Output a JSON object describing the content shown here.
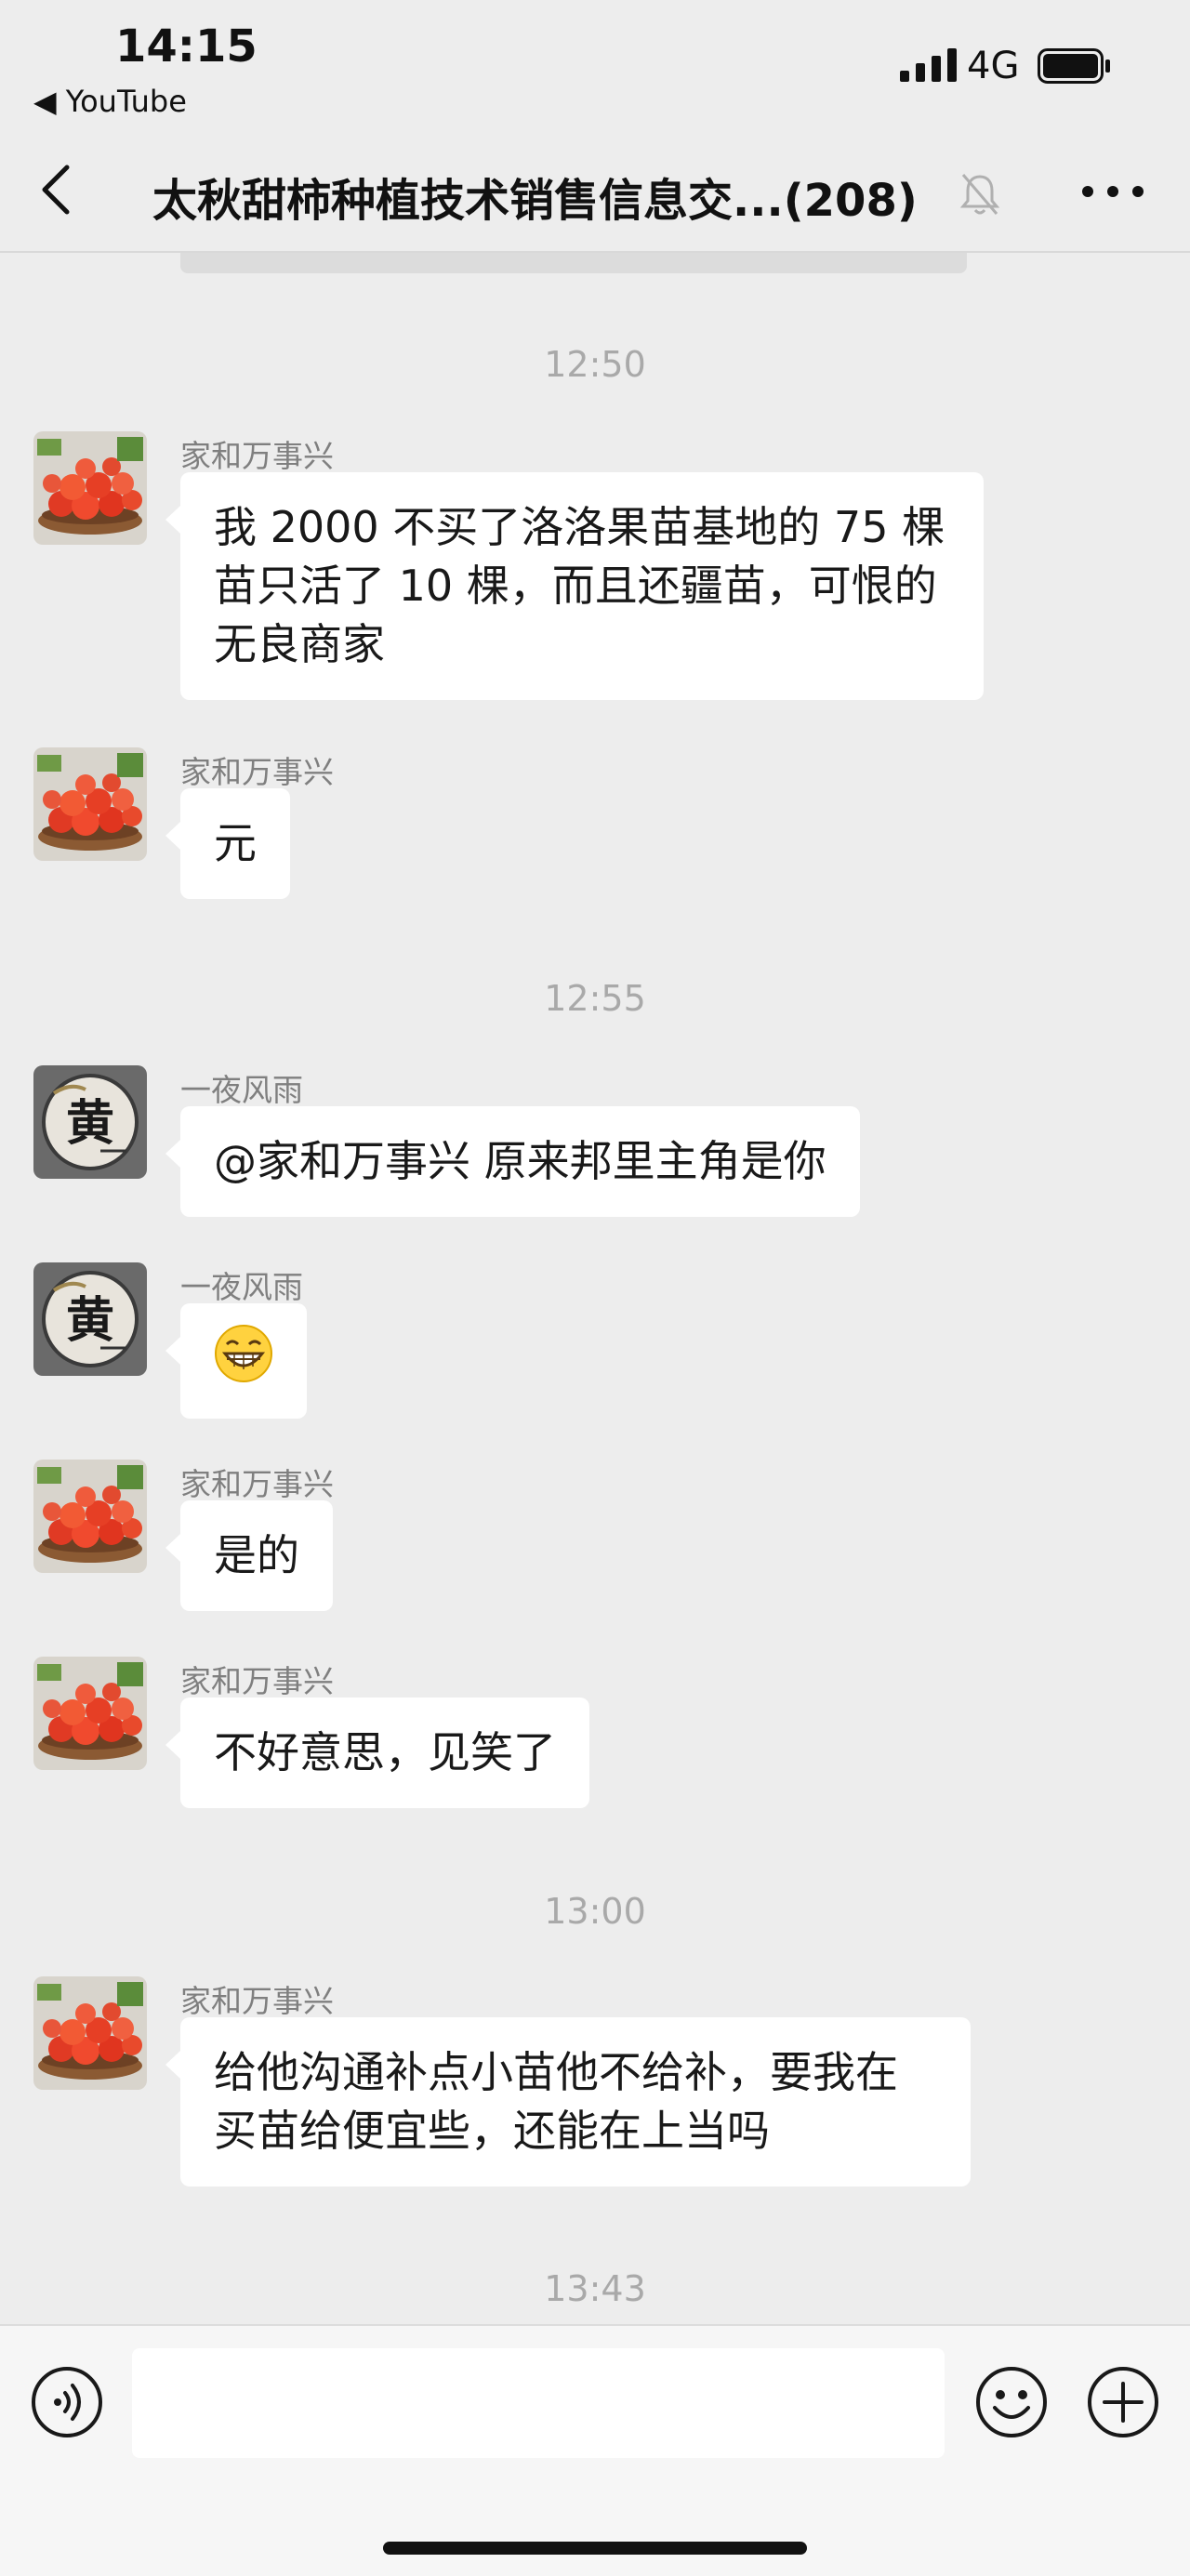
{
  "status_bar": {
    "time": "14:15",
    "back_app": "◀ YouTube",
    "network": "4G"
  },
  "header": {
    "title": "太秋甜柿种植技术销售信息交...(208)"
  },
  "messages": [
    {
      "type": "time",
      "text": "12:50"
    },
    {
      "type": "msg",
      "sender": "家和万事兴",
      "avatar": "persimmon-avatar",
      "text": "我 2000 不买了洛洛果苗基地的 75 棵苗只活了 10 棵，而且还疆苗，可恨的无良商家"
    },
    {
      "type": "msg",
      "sender": "家和万事兴",
      "avatar": "persimmon-avatar",
      "text": "元"
    },
    {
      "type": "time",
      "text": "12:55"
    },
    {
      "type": "msg",
      "sender": "一夜风雨",
      "avatar": "calligraphy-avatar",
      "text": "@家和万事兴 原来邦里主角是你"
    },
    {
      "type": "msg",
      "sender": "一夜风雨",
      "avatar": "calligraphy-avatar",
      "text": "",
      "emoji": "grinning-face"
    },
    {
      "type": "msg",
      "sender": "家和万事兴",
      "avatar": "persimmon-avatar",
      "text": "是的"
    },
    {
      "type": "msg",
      "sender": "家和万事兴",
      "avatar": "persimmon-avatar",
      "text": "不好意思，见笑了"
    },
    {
      "type": "time",
      "text": "13:00"
    },
    {
      "type": "msg",
      "sender": "家和万事兴",
      "avatar": "persimmon-avatar",
      "text": "给他沟通补点小苗他不给补，要我在买苗给便宜些，还能在上当吗"
    },
    {
      "type": "time",
      "text": "13:43"
    }
  ],
  "avatar_text": "黄",
  "input": {
    "value": "",
    "placeholder": ""
  },
  "icons": {
    "back": "chevron-left-icon",
    "mute": "bell-off-icon",
    "more": "more-dots-icon",
    "voice": "voice-icon",
    "emoji": "emoji-icon",
    "plus": "plus-icon"
  },
  "colors": {
    "background": "#ededed",
    "bubble": "#ffffff",
    "sender": "#7f7f7f",
    "time": "#a9a9a9"
  }
}
